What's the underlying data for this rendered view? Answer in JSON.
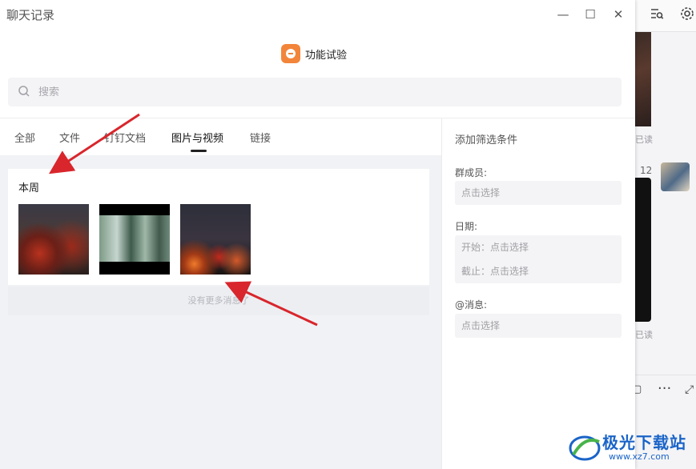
{
  "window": {
    "title": "聊天记录",
    "minimize": "—",
    "maximize": "☐",
    "close": "✕"
  },
  "group": {
    "name": "功能试验",
    "color": "#f2853a"
  },
  "search": {
    "placeholder": "搜索"
  },
  "tabs": [
    {
      "label": "全部",
      "active": false
    },
    {
      "label": "文件",
      "active": false
    },
    {
      "label": "钉钉文档",
      "active": false
    },
    {
      "label": "图片与视频",
      "active": true
    },
    {
      "label": "链接",
      "active": false
    }
  ],
  "media": {
    "section_title": "本周",
    "thumbnails": [
      "image-dark-scene",
      "video-green-landscape",
      "image-fire-night"
    ],
    "no_more": "没有更多消息了"
  },
  "filters": {
    "heading": "添加筛选条件",
    "member_label": "群成员:",
    "member_placeholder": "点击选择",
    "date_label": "日期:",
    "date_start": "开始：点击选择",
    "date_end": "截止：点击选择",
    "mention_label": "@消息:",
    "mention_placeholder": "点击选择"
  },
  "background_chat": {
    "read_1": "已读",
    "time": "12",
    "read_2": "已读"
  },
  "watermark": {
    "text": "极光下载站",
    "url": "www.xz7.com"
  },
  "colors": {
    "accent": "#222222",
    "annotation_arrow": "#d8262c",
    "watermark": "#1a64c8"
  }
}
